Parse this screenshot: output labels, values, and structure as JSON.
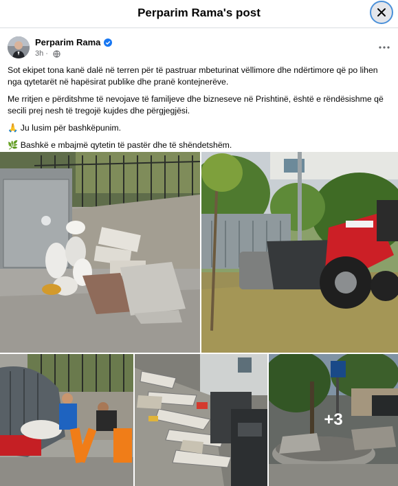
{
  "header": {
    "title": "Perparim Rama's post"
  },
  "post": {
    "author": "Perparim Rama",
    "time": "3h",
    "paragraphs": [
      "Sot ekipet tona kanë dalë në terren për të pastruar mbeturinat vëllimore dhe ndërtimore që po lihen nga qytetarët në hapësirat publike dhe pranë kontejnerëve.",
      "Me rritjen e përditshme të nevojave të familjeve dhe bizneseve në Prishtinë, është e rëndësishme që secili prej nesh të tregojë kujdes dhe përgjegjësi.",
      "🙏 Ju lusim për bashkëpunim.",
      "🌿 Bashkë e mbajmë qytetin të pastër dhe të shëndetshëm."
    ],
    "more_photos": "+3"
  },
  "icons": {
    "close": "close-icon",
    "verified": "verified-badge-icon",
    "audience": "globe-icon",
    "more": "more-options-icon"
  },
  "colors": {
    "accent": "#1877f2",
    "secondary_text": "#65676b"
  }
}
